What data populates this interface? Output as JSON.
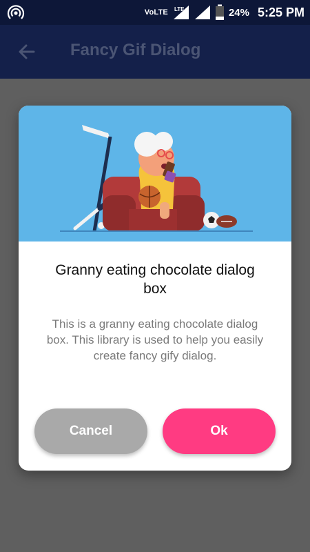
{
  "status_bar": {
    "network_label": "VoLTE",
    "lte_label": "LTE",
    "battery": "24%",
    "time": "5:25 PM",
    "icons": [
      "hotspot-icon",
      "signal-icon",
      "battery-icon"
    ]
  },
  "app_bar": {
    "title": "Fancy Gif Dialog",
    "back_icon": "arrow-back-icon"
  },
  "dialog": {
    "image_description_icon": "granny-eating-chocolate-illustration",
    "title": "Granny eating chocolate dialog box",
    "message": "This is a granny eating chocolate dialog box. This library is used to help you easily create fancy gify dialog.",
    "cancel_label": "Cancel",
    "ok_label": "Ok"
  },
  "colors": {
    "status_bar": "#0d1738",
    "app_bar": "#14204a",
    "overlay": "#5f5f5f",
    "image_bg": "#5eb5e8",
    "cancel": "#a9a9a9",
    "ok": "#ff3b82"
  }
}
